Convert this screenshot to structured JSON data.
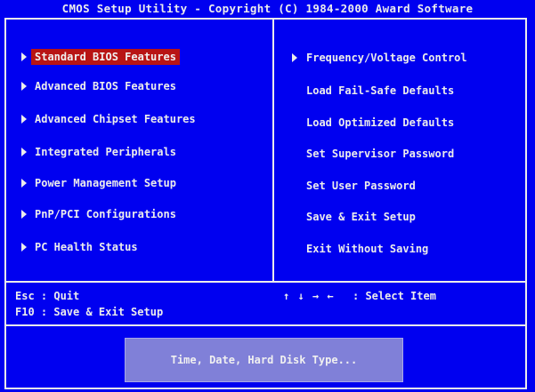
{
  "title": "CMOS Setup Utility - Copyright (C) 1984-2000 Award Software",
  "left_menu": [
    {
      "label": "Standard BIOS Features",
      "selected": true
    },
    {
      "label": "Advanced BIOS Features"
    },
    {
      "label": "Advanced Chipset Features"
    },
    {
      "label": "Integrated Peripherals"
    },
    {
      "label": "Power Management Setup"
    },
    {
      "label": "PnP/PCI Configurations"
    },
    {
      "label": "PC Health Status"
    }
  ],
  "right_menu": [
    {
      "label": "Frequency/Voltage Control",
      "has_arrow": true
    },
    {
      "label": "Load Fail-Safe Defaults"
    },
    {
      "label": "Load Optimized Defaults"
    },
    {
      "label": "Set Supervisor Password"
    },
    {
      "label": "Set User Password"
    },
    {
      "label": "Save & Exit Setup"
    },
    {
      "label": "Exit Without Saving"
    }
  ],
  "help": {
    "esc": "Esc : Quit",
    "f10": "F10 : Save & Exit Setup",
    "arrows": "↑ ↓ → ←",
    "select": ": Select Item"
  },
  "description": "Time, Date, Hard Disk Type...",
  "colors": {
    "background": "#0000f0",
    "highlight": "#b81414",
    "description_box": "#8080d8",
    "text": "#ececec"
  },
  "icons": {
    "menu_marker": "right-triangle-icon"
  }
}
